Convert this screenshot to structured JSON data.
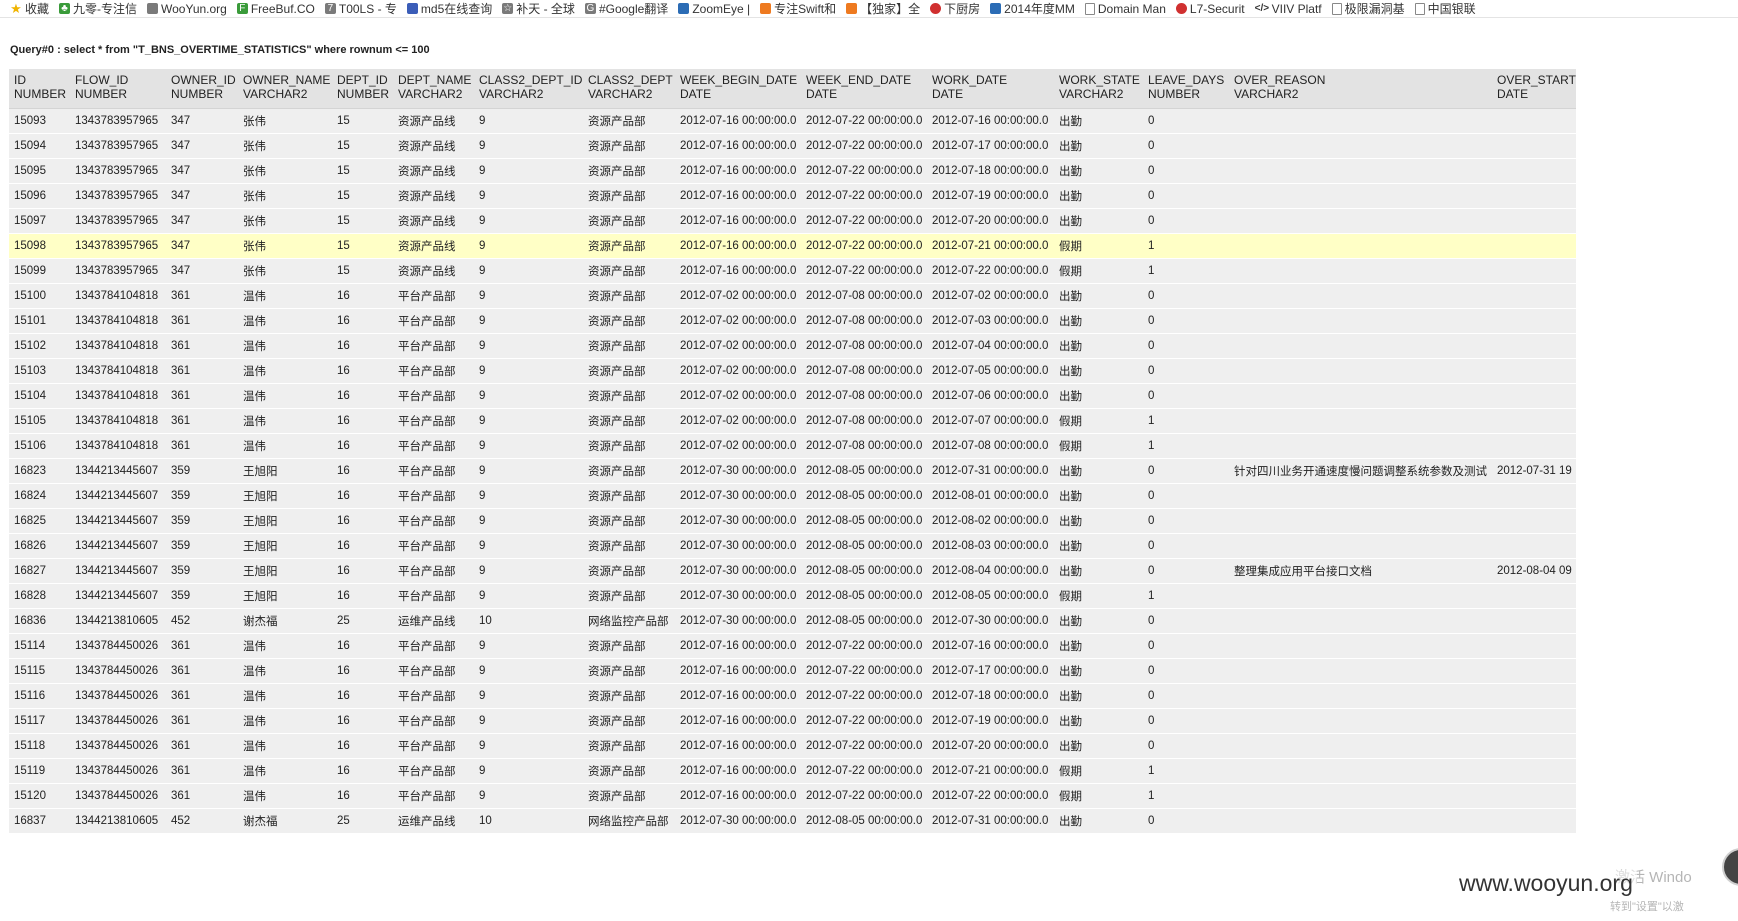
{
  "bookmarks": [
    {
      "label": "收藏",
      "icon": "star-icon",
      "cls": "ic-star",
      "glyph": "★"
    },
    {
      "label": "九零-专注信",
      "icon": "tree-icon",
      "cls": "ic-green",
      "glyph": "♣"
    },
    {
      "label": "WooYun.org",
      "icon": "wooyun-icon",
      "cls": "ic-gray",
      "glyph": ""
    },
    {
      "label": "FreeBuf.CO",
      "icon": "freebuf-icon",
      "cls": "ic-green",
      "glyph": "F"
    },
    {
      "label": "T00LS - 专",
      "icon": "tools-icon",
      "cls": "ic-gray",
      "glyph": "7"
    },
    {
      "label": "md5在线查询",
      "icon": "grid-icon",
      "cls": "ic-grid",
      "glyph": ""
    },
    {
      "label": "补天 - 全球",
      "icon": "star-outline-icon",
      "cls": "ic-gray",
      "glyph": "☆"
    },
    {
      "label": "#Google翻译",
      "icon": "google-translate-icon",
      "cls": "ic-gray",
      "glyph": "G"
    },
    {
      "label": "ZoomEye |",
      "icon": "zoomeye-icon",
      "cls": "ic-blue",
      "glyph": ""
    },
    {
      "label": "专注Swift和",
      "icon": "swift-icon",
      "cls": "ic-orange",
      "glyph": ""
    },
    {
      "label": "【独家】全",
      "icon": "arrow-icon",
      "cls": "ic-orange",
      "glyph": ""
    },
    {
      "label": "下厨房",
      "icon": "kitchen-icon",
      "cls": "ic-red",
      "glyph": ""
    },
    {
      "label": "2014年度MM",
      "icon": "clock-icon",
      "cls": "ic-blue",
      "glyph": ""
    },
    {
      "label": "Domain Man",
      "icon": "page-icon",
      "cls": "ic-page",
      "glyph": ""
    },
    {
      "label": "L7-Securit",
      "icon": "l7-icon",
      "cls": "ic-red",
      "glyph": ""
    },
    {
      "label": "VIIV Platf",
      "icon": "code-icon",
      "cls": "ic-code",
      "glyph": "</>"
    },
    {
      "label": "极限漏洞基",
      "icon": "page-icon",
      "cls": "ic-page",
      "glyph": ""
    },
    {
      "label": "中国银联",
      "icon": "page-icon",
      "cls": "ic-page",
      "glyph": ""
    }
  ],
  "query_text": "Query#0 : select * from \"T_BNS_OVERTIME_STATISTICS\" where rownum <= 100",
  "columns": [
    {
      "name": "ID",
      "type": "NUMBER"
    },
    {
      "name": "FLOW_ID",
      "type": "NUMBER"
    },
    {
      "name": "OWNER_ID",
      "type": "NUMBER"
    },
    {
      "name": "OWNER_NAME",
      "type": "VARCHAR2"
    },
    {
      "name": "DEPT_ID",
      "type": "NUMBER"
    },
    {
      "name": "DEPT_NAME",
      "type": "VARCHAR2"
    },
    {
      "name": "CLASS2_DEPT_ID",
      "type": "VARCHAR2"
    },
    {
      "name": "CLASS2_DEPT",
      "type": "VARCHAR2"
    },
    {
      "name": "WEEK_BEGIN_DATE",
      "type": "DATE"
    },
    {
      "name": "WEEK_END_DATE",
      "type": "DATE"
    },
    {
      "name": "WORK_DATE",
      "type": "DATE"
    },
    {
      "name": "WORK_STATE",
      "type": "VARCHAR2"
    },
    {
      "name": "LEAVE_DAYS",
      "type": "NUMBER"
    },
    {
      "name": "OVER_REASON",
      "type": "VARCHAR2"
    },
    {
      "name": "OVER_START",
      "type": "DATE"
    }
  ],
  "highlighted_row_id": "15098",
  "rows": [
    [
      "15093",
      "1343783957965",
      "347",
      "张伟",
      "15",
      "资源产品线",
      "9",
      "资源产品部",
      "2012-07-16 00:00:00.0",
      "2012-07-22 00:00:00.0",
      "2012-07-16 00:00:00.0",
      "出勤",
      "0",
      "",
      ""
    ],
    [
      "15094",
      "1343783957965",
      "347",
      "张伟",
      "15",
      "资源产品线",
      "9",
      "资源产品部",
      "2012-07-16 00:00:00.0",
      "2012-07-22 00:00:00.0",
      "2012-07-17 00:00:00.0",
      "出勤",
      "0",
      "",
      ""
    ],
    [
      "15095",
      "1343783957965",
      "347",
      "张伟",
      "15",
      "资源产品线",
      "9",
      "资源产品部",
      "2012-07-16 00:00:00.0",
      "2012-07-22 00:00:00.0",
      "2012-07-18 00:00:00.0",
      "出勤",
      "0",
      "",
      ""
    ],
    [
      "15096",
      "1343783957965",
      "347",
      "张伟",
      "15",
      "资源产品线",
      "9",
      "资源产品部",
      "2012-07-16 00:00:00.0",
      "2012-07-22 00:00:00.0",
      "2012-07-19 00:00:00.0",
      "出勤",
      "0",
      "",
      ""
    ],
    [
      "15097",
      "1343783957965",
      "347",
      "张伟",
      "15",
      "资源产品线",
      "9",
      "资源产品部",
      "2012-07-16 00:00:00.0",
      "2012-07-22 00:00:00.0",
      "2012-07-20 00:00:00.0",
      "出勤",
      "0",
      "",
      ""
    ],
    [
      "15098",
      "1343783957965",
      "347",
      "张伟",
      "15",
      "资源产品线",
      "9",
      "资源产品部",
      "2012-07-16 00:00:00.0",
      "2012-07-22 00:00:00.0",
      "2012-07-21 00:00:00.0",
      "假期",
      "1",
      "",
      ""
    ],
    [
      "15099",
      "1343783957965",
      "347",
      "张伟",
      "15",
      "资源产品线",
      "9",
      "资源产品部",
      "2012-07-16 00:00:00.0",
      "2012-07-22 00:00:00.0",
      "2012-07-22 00:00:00.0",
      "假期",
      "1",
      "",
      ""
    ],
    [
      "15100",
      "1343784104818",
      "361",
      "温伟",
      "16",
      "平台产品部",
      "9",
      "资源产品部",
      "2012-07-02 00:00:00.0",
      "2012-07-08 00:00:00.0",
      "2012-07-02 00:00:00.0",
      "出勤",
      "0",
      "",
      ""
    ],
    [
      "15101",
      "1343784104818",
      "361",
      "温伟",
      "16",
      "平台产品部",
      "9",
      "资源产品部",
      "2012-07-02 00:00:00.0",
      "2012-07-08 00:00:00.0",
      "2012-07-03 00:00:00.0",
      "出勤",
      "0",
      "",
      ""
    ],
    [
      "15102",
      "1343784104818",
      "361",
      "温伟",
      "16",
      "平台产品部",
      "9",
      "资源产品部",
      "2012-07-02 00:00:00.0",
      "2012-07-08 00:00:00.0",
      "2012-07-04 00:00:00.0",
      "出勤",
      "0",
      "",
      ""
    ],
    [
      "15103",
      "1343784104818",
      "361",
      "温伟",
      "16",
      "平台产品部",
      "9",
      "资源产品部",
      "2012-07-02 00:00:00.0",
      "2012-07-08 00:00:00.0",
      "2012-07-05 00:00:00.0",
      "出勤",
      "0",
      "",
      ""
    ],
    [
      "15104",
      "1343784104818",
      "361",
      "温伟",
      "16",
      "平台产品部",
      "9",
      "资源产品部",
      "2012-07-02 00:00:00.0",
      "2012-07-08 00:00:00.0",
      "2012-07-06 00:00:00.0",
      "出勤",
      "0",
      "",
      ""
    ],
    [
      "15105",
      "1343784104818",
      "361",
      "温伟",
      "16",
      "平台产品部",
      "9",
      "资源产品部",
      "2012-07-02 00:00:00.0",
      "2012-07-08 00:00:00.0",
      "2012-07-07 00:00:00.0",
      "假期",
      "1",
      "",
      ""
    ],
    [
      "15106",
      "1343784104818",
      "361",
      "温伟",
      "16",
      "平台产品部",
      "9",
      "资源产品部",
      "2012-07-02 00:00:00.0",
      "2012-07-08 00:00:00.0",
      "2012-07-08 00:00:00.0",
      "假期",
      "1",
      "",
      ""
    ],
    [
      "16823",
      "1344213445607",
      "359",
      "王旭阳",
      "16",
      "平台产品部",
      "9",
      "资源产品部",
      "2012-07-30 00:00:00.0",
      "2012-08-05 00:00:00.0",
      "2012-07-31 00:00:00.0",
      "出勤",
      "0",
      "针对四川业务开通速度慢问题调整系统参数及测试",
      "2012-07-31 19"
    ],
    [
      "16824",
      "1344213445607",
      "359",
      "王旭阳",
      "16",
      "平台产品部",
      "9",
      "资源产品部",
      "2012-07-30 00:00:00.0",
      "2012-08-05 00:00:00.0",
      "2012-08-01 00:00:00.0",
      "出勤",
      "0",
      "",
      ""
    ],
    [
      "16825",
      "1344213445607",
      "359",
      "王旭阳",
      "16",
      "平台产品部",
      "9",
      "资源产品部",
      "2012-07-30 00:00:00.0",
      "2012-08-05 00:00:00.0",
      "2012-08-02 00:00:00.0",
      "出勤",
      "0",
      "",
      ""
    ],
    [
      "16826",
      "1344213445607",
      "359",
      "王旭阳",
      "16",
      "平台产品部",
      "9",
      "资源产品部",
      "2012-07-30 00:00:00.0",
      "2012-08-05 00:00:00.0",
      "2012-08-03 00:00:00.0",
      "出勤",
      "0",
      "",
      ""
    ],
    [
      "16827",
      "1344213445607",
      "359",
      "王旭阳",
      "16",
      "平台产品部",
      "9",
      "资源产品部",
      "2012-07-30 00:00:00.0",
      "2012-08-05 00:00:00.0",
      "2012-08-04 00:00:00.0",
      "出勤",
      "0",
      "整理集成应用平台接口文档",
      "2012-08-04 09"
    ],
    [
      "16828",
      "1344213445607",
      "359",
      "王旭阳",
      "16",
      "平台产品部",
      "9",
      "资源产品部",
      "2012-07-30 00:00:00.0",
      "2012-08-05 00:00:00.0",
      "2012-08-05 00:00:00.0",
      "假期",
      "1",
      "",
      ""
    ],
    [
      "16836",
      "1344213810605",
      "452",
      "谢杰福",
      "25",
      "运维产品线",
      "10",
      "网络监控产品部",
      "2012-07-30 00:00:00.0",
      "2012-08-05 00:00:00.0",
      "2012-07-30 00:00:00.0",
      "出勤",
      "0",
      "",
      ""
    ],
    [
      "15114",
      "1343784450026",
      "361",
      "温伟",
      "16",
      "平台产品部",
      "9",
      "资源产品部",
      "2012-07-16 00:00:00.0",
      "2012-07-22 00:00:00.0",
      "2012-07-16 00:00:00.0",
      "出勤",
      "0",
      "",
      ""
    ],
    [
      "15115",
      "1343784450026",
      "361",
      "温伟",
      "16",
      "平台产品部",
      "9",
      "资源产品部",
      "2012-07-16 00:00:00.0",
      "2012-07-22 00:00:00.0",
      "2012-07-17 00:00:00.0",
      "出勤",
      "0",
      "",
      ""
    ],
    [
      "15116",
      "1343784450026",
      "361",
      "温伟",
      "16",
      "平台产品部",
      "9",
      "资源产品部",
      "2012-07-16 00:00:00.0",
      "2012-07-22 00:00:00.0",
      "2012-07-18 00:00:00.0",
      "出勤",
      "0",
      "",
      ""
    ],
    [
      "15117",
      "1343784450026",
      "361",
      "温伟",
      "16",
      "平台产品部",
      "9",
      "资源产品部",
      "2012-07-16 00:00:00.0",
      "2012-07-22 00:00:00.0",
      "2012-07-19 00:00:00.0",
      "出勤",
      "0",
      "",
      ""
    ],
    [
      "15118",
      "1343784450026",
      "361",
      "温伟",
      "16",
      "平台产品部",
      "9",
      "资源产品部",
      "2012-07-16 00:00:00.0",
      "2012-07-22 00:00:00.0",
      "2012-07-20 00:00:00.0",
      "出勤",
      "0",
      "",
      ""
    ],
    [
      "15119",
      "1343784450026",
      "361",
      "温伟",
      "16",
      "平台产品部",
      "9",
      "资源产品部",
      "2012-07-16 00:00:00.0",
      "2012-07-22 00:00:00.0",
      "2012-07-21 00:00:00.0",
      "假期",
      "1",
      "",
      ""
    ],
    [
      "15120",
      "1343784450026",
      "361",
      "温伟",
      "16",
      "平台产品部",
      "9",
      "资源产品部",
      "2012-07-16 00:00:00.0",
      "2012-07-22 00:00:00.0",
      "2012-07-22 00:00:00.0",
      "假期",
      "1",
      "",
      ""
    ],
    [
      "16837",
      "1344213810605",
      "452",
      "谢杰福",
      "25",
      "运维产品线",
      "10",
      "网络监控产品部",
      "2012-07-30 00:00:00.0",
      "2012-08-05 00:00:00.0",
      "2012-07-31 00:00:00.0",
      "出勤",
      "0",
      "",
      ""
    ]
  ],
  "watermark": "www.wooyun.org",
  "activate_line1": "激活 Windo",
  "activate_line2": "转到\"设置\"以激"
}
